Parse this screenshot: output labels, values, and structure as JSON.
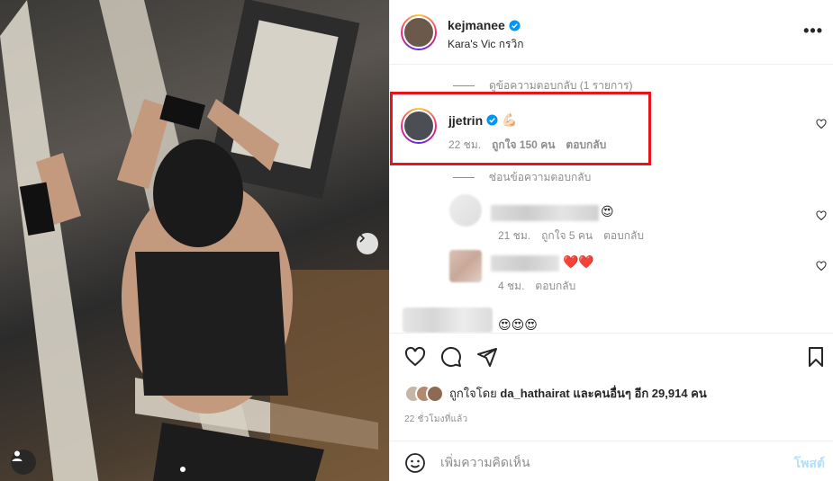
{
  "post": {
    "username": "kejmanee",
    "location": "Kara's Vic กรวิก",
    "more_label": "•••"
  },
  "comments": {
    "view_replies": "ดูข้อความตอบกลับ (1 รายการ)",
    "hide_replies": "ซ่อนข้อความตอบกลับ",
    "highlighted": {
      "username": "jjetrin",
      "emoji": "💪🏻",
      "time": "22 ชม.",
      "likes": "ถูกใจ 150 คน",
      "reply": "ตอบกลับ"
    },
    "replies": [
      {
        "emoji": "😍",
        "time": "21 ชม.",
        "likes": "ถูกใจ 5 คน",
        "reply": "ตอบกลับ"
      },
      {
        "emoji": "❤️❤️",
        "time": "4 ชม.",
        "reply": "ตอบกลับ"
      }
    ],
    "next_emoji": "😍😍😍"
  },
  "actions": {
    "liked_by_prefix": "ถูกใจโดย",
    "liked_by_user": "da_hathairat",
    "liked_by_suffix": "และคนอื่นๆ อีก 29,914 คน",
    "time_ago": "22 ชั่วโมงที่แล้ว"
  },
  "composer": {
    "placeholder": "เพิ่มความคิดเห็น",
    "post_label": "โพสต์"
  },
  "colors": {
    "highlight_border": "#e8141a",
    "verified": "#0095f6",
    "post_button_disabled": "#b2dffc"
  },
  "icons": [
    "chevron-right-icon",
    "user-tag-icon",
    "verified-icon",
    "more-icon",
    "heart-icon",
    "comment-icon",
    "share-icon",
    "bookmark-icon",
    "emoji-icon"
  ]
}
